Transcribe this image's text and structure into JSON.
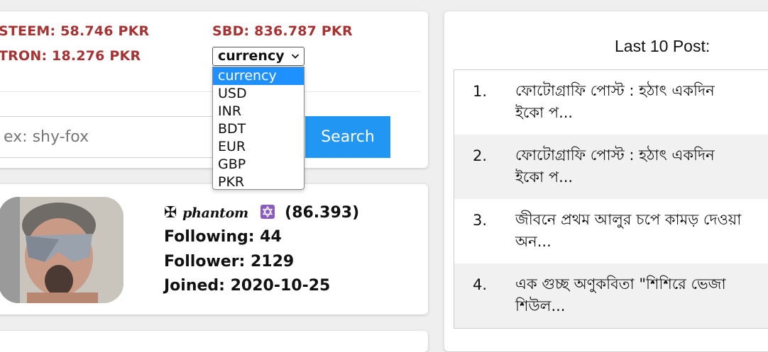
{
  "prices": {
    "steem": "STEEM: 58.746 PKR",
    "tron": "TRON: 18.276 PKR",
    "sbd": "SBD: 836.787 PKR"
  },
  "currency_select": {
    "value": "currency",
    "options": [
      "currency",
      "USD",
      "INR",
      "BDT",
      "EUR",
      "GBP",
      "PKR"
    ]
  },
  "search": {
    "placeholder": "ex: shy-fox",
    "button_label": "Search"
  },
  "profile": {
    "name_prefix": "✠",
    "name": "phantom",
    "badge_icon": "star-of-david-icon",
    "reputation": "(86.393)",
    "following": "Following: 44",
    "follower": "Follower: 2129",
    "joined": "Joined: 2020-10-25"
  },
  "posts": {
    "title": "Last 10 Post:",
    "items": [
      {
        "num": "1.",
        "text": "ফোটোগ্রাফি পোস্ট : হঠাৎ একদিন\nইকো প..."
      },
      {
        "num": "2.",
        "text": "ফোটোগ্রাফি পোস্ট : হঠাৎ একদিন\nইকো প..."
      },
      {
        "num": "3.",
        "text": "জীবনে প্রথম আলুর চপে কামড় দেওয়া\nঅন..."
      },
      {
        "num": "4.",
        "text": "এক গুচ্ছ অণুকবিতা \"শিশিরে ভেজা\nশিউল..."
      }
    ]
  },
  "colors": {
    "price_text": "#a83232",
    "search_button": "#2196f3",
    "selected_option": "#1e90ff",
    "badge": "#8a5cc2"
  }
}
